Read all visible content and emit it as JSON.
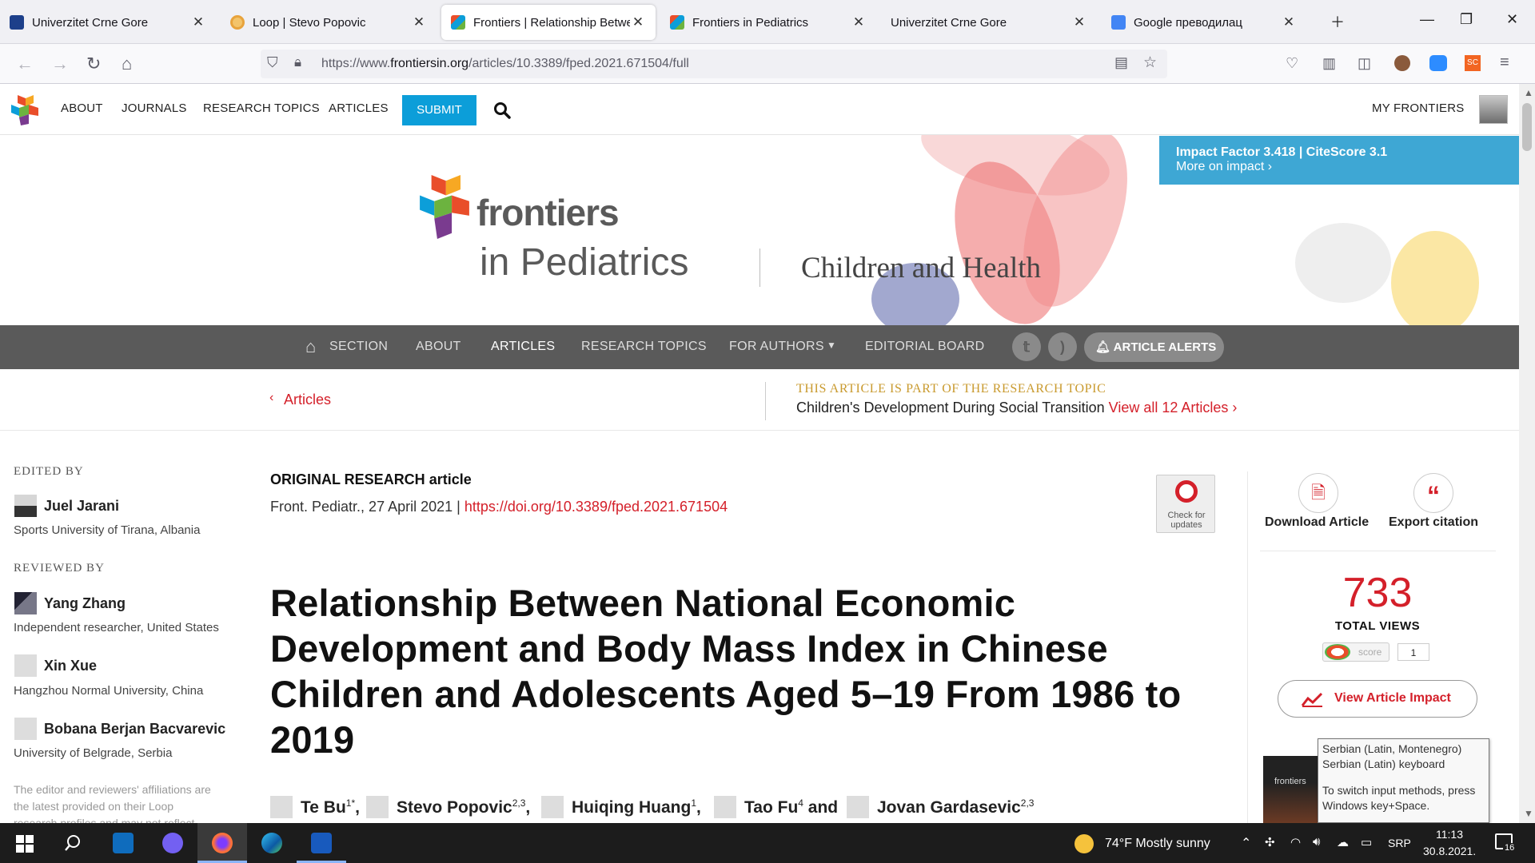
{
  "browser": {
    "tabs": [
      {
        "label": "Univerzitet Crne Gore",
        "fav_color": "#1d3f8a"
      },
      {
        "label": "Loop | Stevo Popovic",
        "fav_color": "#e8a33c"
      },
      {
        "label": "Frontiers | Relationship Betwee",
        "fav_color": "#e94e2a"
      },
      {
        "label": "Frontiers in Pediatrics",
        "fav_color": "#e94e2a"
      },
      {
        "label": "Univerzitet Crne Gore",
        "fav_color": "#ffffff"
      },
      {
        "label": "Google преводилац",
        "fav_color": "#4285f4"
      }
    ],
    "url_prefix": "https://www.",
    "url_domain": "frontiersin.org",
    "url_path": "/articles/10.3389/fped.2021.671504/full"
  },
  "site_nav": {
    "items": [
      "ABOUT",
      "JOURNALS",
      "RESEARCH TOPICS",
      "ARTICLES"
    ],
    "submit": "SUBMIT",
    "my_frontiers": "MY FRONTIERS"
  },
  "banner": {
    "brand": "frontiers",
    "journal": "in Pediatrics",
    "section": "Children and Health",
    "impact_factor": "Impact Factor 3.418",
    "citescore": "CiteScore 3.1",
    "more_on_impact": "More on impact ›"
  },
  "section_nav": {
    "items": [
      "SECTION",
      "ABOUT",
      "ARTICLES",
      "RESEARCH TOPICS",
      "FOR AUTHORS",
      "EDITORIAL BOARD"
    ],
    "alerts": "ARTICLE ALERTS"
  },
  "crumb": {
    "back": "Articles",
    "topic_kicker": "THIS ARTICLE IS PART OF THE RESEARCH TOPIC",
    "topic_title": "Children's Development During Social Transition",
    "view_all": "View all 12 Articles ›"
  },
  "sidebar": {
    "edited_by": "EDITED BY",
    "editor": {
      "name": "Juel Jarani",
      "affiliation": "Sports University of Tirana, Albania"
    },
    "reviewed_by": "REVIEWED BY",
    "reviewers": [
      {
        "name": "Yang Zhang",
        "affiliation": "Independent researcher, United States"
      },
      {
        "name": "Xin Xue",
        "affiliation": "Hangzhou Normal University, China"
      },
      {
        "name": "Bobana Berjan Bacvarevic",
        "affiliation": "University of Belgrade, Serbia"
      }
    ],
    "note": "The editor and reviewers' affiliations are the latest provided on their Loop research profiles and may not reflect"
  },
  "article": {
    "type_bold": "ORIGINAL RESEARCH",
    "type_rest": " article",
    "meta": "Front. Pediatr., 27 April 2021 | ",
    "doi": "https://doi.org/10.3389/fped.2021.671504",
    "check_updates": "Check for updates",
    "title": "Relationship Between National Economic Development and Body Mass Index in Chinese Children and Adolescents Aged 5–19 From 1986 to 2019",
    "authors": [
      {
        "name": "Te Bu",
        "sup": "1*",
        "sep": ","
      },
      {
        "name": "Stevo Popovic",
        "sup": "2,3",
        "sep": ","
      },
      {
        "name": "Huiqing Huang",
        "sup": "1",
        "sep": ","
      },
      {
        "name": "Tao Fu",
        "sup": "4",
        "sep": " and"
      },
      {
        "name": "Jovan Gardasevic",
        "sup": "2,3",
        "sep": ""
      }
    ]
  },
  "right_panel": {
    "download": "Download Article",
    "export": "Export citation",
    "views": "733",
    "views_label": "TOTAL VIEWS",
    "altmetric_score": "1",
    "view_impact": "View Article Impact"
  },
  "tooltip": {
    "line1": "Serbian (Latin, Montenegro)",
    "line2": "Serbian (Latin) keyboard",
    "line3": "To switch input methods, press Windows key+Space."
  },
  "taskbar": {
    "weather": "74°F  Mostly sunny",
    "lang": "SRP",
    "time": "11:13",
    "date": "30.8.2021.",
    "notif_count": "16"
  },
  "colors": {
    "accent_blue": "#0c9ed9",
    "link_red": "#d4202a",
    "topic_gold": "#c99a2e",
    "section_bar": "#5a5a5a"
  }
}
